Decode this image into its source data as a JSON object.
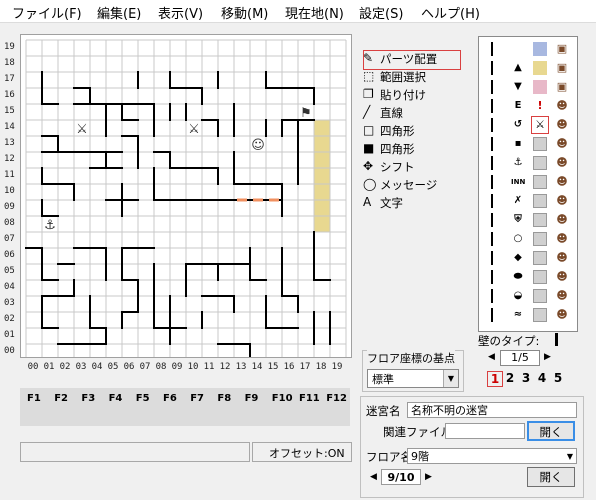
{
  "menu": {
    "items": [
      {
        "label": "ファイル(F)",
        "name": "menu-file"
      },
      {
        "label": "編集(E)",
        "name": "menu-edit"
      },
      {
        "label": "表示(V)",
        "name": "menu-view"
      },
      {
        "label": "移動(M)",
        "name": "menu-move"
      },
      {
        "label": "現在地(N)",
        "name": "menu-location"
      },
      {
        "label": "設定(S)",
        "name": "menu-settings"
      },
      {
        "label": "ヘルプ(H)",
        "name": "menu-help"
      }
    ]
  },
  "map": {
    "y_labels": [
      "19",
      "18",
      "17",
      "16",
      "15",
      "14",
      "13",
      "12",
      "11",
      "10",
      "09",
      "08",
      "07",
      "06",
      "05",
      "04",
      "03",
      "02",
      "01",
      "00"
    ],
    "x_labels": [
      "00",
      "01",
      "02",
      "03",
      "04",
      "05",
      "06",
      "07",
      "08",
      "09",
      "10",
      "11",
      "12",
      "13",
      "14",
      "15",
      "16",
      "17",
      "18",
      "19"
    ],
    "markers": [
      {
        "icon": "crossed-swords-icon",
        "glyph": "⚔",
        "col": 3,
        "row": 14
      },
      {
        "icon": "crossed-swords-icon",
        "glyph": "⚔",
        "col": 10,
        "row": 14
      },
      {
        "icon": "monster-face-icon",
        "glyph": "☺",
        "col": 14,
        "row": 13
      },
      {
        "icon": "stairs-icon",
        "glyph": "⚑",
        "col": 17,
        "row": 15
      },
      {
        "icon": "start-point-icon",
        "glyph": "⚓",
        "col": 1,
        "row": 8
      }
    ]
  },
  "tools": [
    {
      "label": "パーツ配置",
      "icon": "pencil-icon",
      "name": "tool-place-parts"
    },
    {
      "label": "範囲選択",
      "icon": "dotted-rect-icon",
      "name": "tool-range-select"
    },
    {
      "label": "貼り付け",
      "icon": "paste-icon",
      "name": "tool-paste"
    },
    {
      "label": "直線",
      "icon": "line-icon",
      "name": "tool-line"
    },
    {
      "label": "四角形",
      "icon": "square-outline-icon",
      "name": "tool-rect-outline"
    },
    {
      "label": "四角形",
      "icon": "square-filled-icon",
      "name": "tool-rect-filled"
    },
    {
      "label": "シフト",
      "icon": "move-arrows-icon",
      "name": "tool-shift"
    },
    {
      "label": "メッセージ",
      "icon": "speech-bubble-icon",
      "name": "tool-message"
    },
    {
      "label": "文字",
      "icon": "text-icon",
      "name": "tool-text"
    }
  ],
  "palette": {
    "wall_type_label": "壁のタイプ:",
    "page": "1/5",
    "page_numbers": [
      "1",
      "2",
      "3",
      "4",
      "5"
    ],
    "selected_page": "1"
  },
  "floor_origin": {
    "label": "フロア座標の基点",
    "value": "標準"
  },
  "fkeys": [
    "F1",
    "F2",
    "F3",
    "F4",
    "F5",
    "F6",
    "F7",
    "F8",
    "F9",
    "F10",
    "F11",
    "F12"
  ],
  "status": {
    "left": "",
    "offset": "オフセット:ON"
  },
  "dungeon": {
    "name_label": "迷宮名",
    "name_value": "名称不明の迷宮",
    "related_file_label": "関連ファイル",
    "related_file_value": "",
    "open_label": "開く",
    "floor_label": "フロア名",
    "floor_value": "9階",
    "floor_page": "9/10",
    "open2_label": "開く"
  },
  "colors": {
    "wall": "#000000",
    "grid": "#c8c8c8",
    "highlight_yellow": "#e8d890",
    "door_orange": "#f09060",
    "selection_red": "#d94040"
  }
}
